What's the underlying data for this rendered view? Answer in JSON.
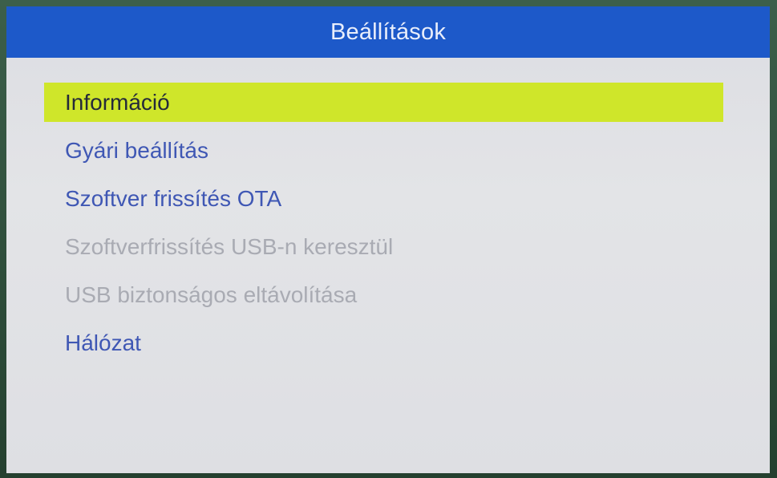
{
  "dialog": {
    "title": "Beállítások"
  },
  "menu": {
    "items": [
      {
        "label": "Információ",
        "state": "selected"
      },
      {
        "label": "Gyári beállítás",
        "state": "enabled"
      },
      {
        "label": "Szoftver frissítés OTA",
        "state": "enabled"
      },
      {
        "label": "Szoftverfrissítés USB-n keresztül",
        "state": "disabled"
      },
      {
        "label": "USB biztonságos eltávolítása",
        "state": "disabled"
      },
      {
        "label": "Hálózat",
        "state": "enabled"
      }
    ]
  },
  "colors": {
    "title_bar": "#1d59c9",
    "selection_highlight": "#cfe62a",
    "enabled_text": "#3f57b4",
    "disabled_text": "#a9abb3",
    "selected_text": "#252a3a",
    "dialog_background": "#e0e1e5"
  }
}
